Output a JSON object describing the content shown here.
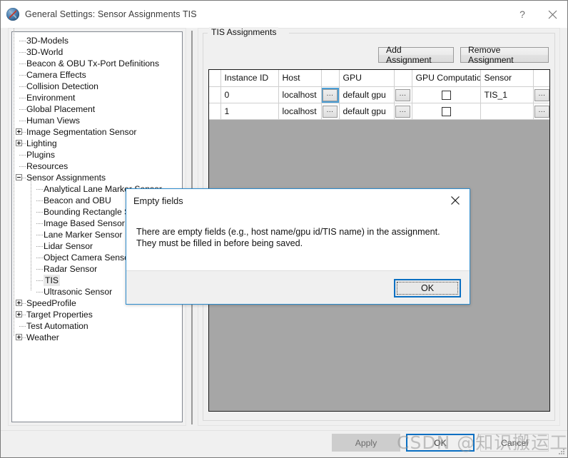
{
  "window": {
    "title": "General Settings: Sensor Assignments TIS",
    "icon": "globe-compass-icon",
    "help_label": "?",
    "close_label": "✕"
  },
  "tree": {
    "items": [
      {
        "label": "3D-Models",
        "level": 1,
        "expander": "none"
      },
      {
        "label": "3D-World",
        "level": 1,
        "expander": "none"
      },
      {
        "label": "Beacon & OBU Tx-Port Definitions",
        "level": 1,
        "expander": "none"
      },
      {
        "label": "Camera Effects",
        "level": 1,
        "expander": "none"
      },
      {
        "label": "Collision Detection",
        "level": 1,
        "expander": "none"
      },
      {
        "label": "Environment",
        "level": 1,
        "expander": "none"
      },
      {
        "label": "Global Placement",
        "level": 1,
        "expander": "none"
      },
      {
        "label": "Human Views",
        "level": 1,
        "expander": "none"
      },
      {
        "label": "Image Segmentation Sensor",
        "level": 1,
        "expander": "plus"
      },
      {
        "label": "Lighting",
        "level": 1,
        "expander": "plus"
      },
      {
        "label": "Plugins",
        "level": 1,
        "expander": "none"
      },
      {
        "label": "Resources",
        "level": 1,
        "expander": "none"
      },
      {
        "label": "Sensor Assignments",
        "level": 1,
        "expander": "minus"
      },
      {
        "label": "Analytical Lane Marker Sensor",
        "level": 2,
        "expander": "none"
      },
      {
        "label": "Beacon and OBU",
        "level": 2,
        "expander": "none"
      },
      {
        "label": "Bounding Rectangle Sensor",
        "level": 2,
        "expander": "none"
      },
      {
        "label": "Image Based Sensor",
        "level": 2,
        "expander": "none"
      },
      {
        "label": "Lane Marker Sensor",
        "level": 2,
        "expander": "none"
      },
      {
        "label": "Lidar Sensor",
        "level": 2,
        "expander": "none"
      },
      {
        "label": "Object Camera Sensor",
        "level": 2,
        "expander": "none"
      },
      {
        "label": "Radar Sensor",
        "level": 2,
        "expander": "none",
        "selected": false
      },
      {
        "label": "TIS",
        "level": 2,
        "expander": "none",
        "selected": true
      },
      {
        "label": "Ultrasonic Sensor",
        "level": 2,
        "expander": "none"
      },
      {
        "label": "SpeedProfile",
        "level": 1,
        "expander": "plus"
      },
      {
        "label": "Target Properties",
        "level": 1,
        "expander": "plus"
      },
      {
        "label": "Test Automation",
        "level": 1,
        "expander": "none"
      },
      {
        "label": "Weather",
        "level": 1,
        "expander": "plus"
      }
    ]
  },
  "panel": {
    "group_title": "TIS Assignments",
    "add_button": "Add Assignment",
    "remove_button": "Remove Assignment",
    "table": {
      "headers": [
        "",
        "Instance ID",
        "Host",
        "",
        "GPU",
        "",
        "GPU Computation",
        "Sensor",
        ""
      ],
      "rows": [
        {
          "instance_id": "0",
          "host": "localhost",
          "host_browse": "...",
          "gpu": "default gpu",
          "gpu_browse": "...",
          "gpu_computation_checked": false,
          "sensor": "TIS_1",
          "sensor_browse": "..."
        },
        {
          "instance_id": "1",
          "host": "localhost",
          "host_browse": "...",
          "gpu": "default gpu",
          "gpu_browse": "...",
          "gpu_computation_checked": false,
          "sensor": "",
          "sensor_browse": "..."
        }
      ]
    }
  },
  "footer": {
    "apply": "Apply",
    "ok": "OK",
    "cancel": "Cancel"
  },
  "dialog": {
    "title": "Empty fields",
    "close_label": "✕",
    "message": "There are empty fields (e.g., host name/gpu id/TIS name) in the assignment. They must be filled in before being saved.",
    "ok": "OK"
  },
  "watermark": {
    "text": "CSDN @知识搬运工阿杰"
  },
  "colors": {
    "accent": "#0a6fc2",
    "grid_background": "#a6a6a6",
    "panel": "#f0f0f0"
  }
}
